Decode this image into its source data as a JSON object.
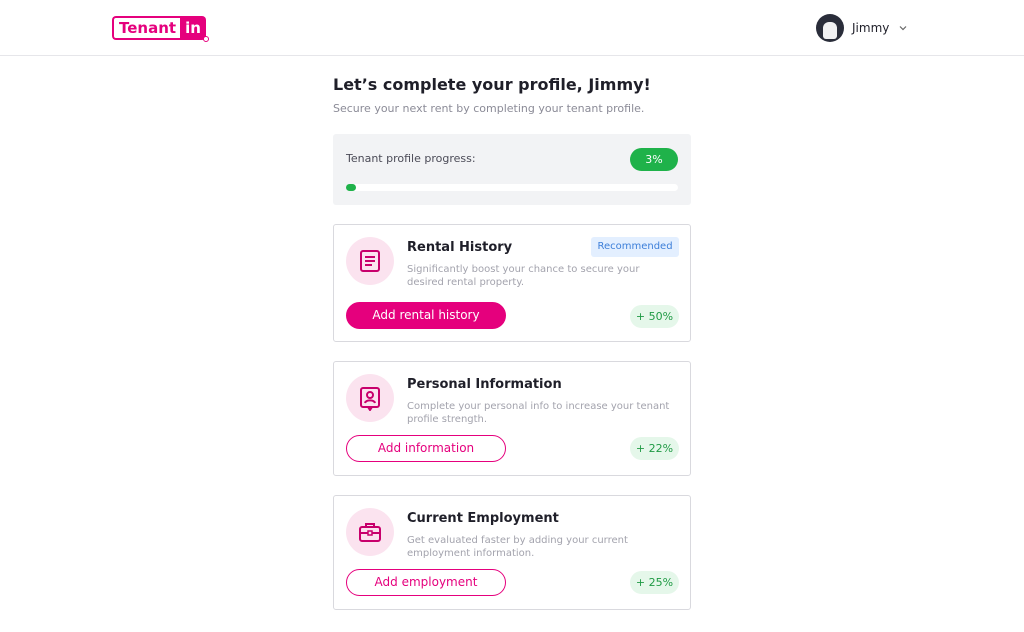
{
  "header": {
    "logo_text_left": "Tenant",
    "logo_text_right": "in",
    "user_name": "Jimmy",
    "icons": {
      "avatar": "user-avatar",
      "dropdown": "chevron-down-icon"
    }
  },
  "main": {
    "title": "Let’s complete your profile, Jimmy!",
    "subtitle": "Secure your next rent by completing your tenant profile.",
    "progress": {
      "label": "Tenant profile progress:",
      "value_text": "3%",
      "value": 0.03
    },
    "cards": [
      {
        "title": "Rental History",
        "badge": "Recommended",
        "description": "Significantly boost your chance to secure your desired rental property.",
        "button_label": "Add rental history",
        "boost": "+ 50%",
        "icon": "document-icon"
      },
      {
        "title": "Personal Information",
        "description": "Complete your  personal info to increase your tenant profile strength.",
        "button_label": "Add information",
        "boost": "+ 22%",
        "icon": "id-badge-icon"
      },
      {
        "title": "Current Employment",
        "description": "Get evaluated faster by adding your current employment information.",
        "button_label": "Add employment",
        "boost": "+ 25%",
        "icon": "briefcase-icon"
      }
    ]
  },
  "colors": {
    "brand": "#e5007d",
    "success": "#1fb24a",
    "badge_blue": "#3d7fd9"
  }
}
